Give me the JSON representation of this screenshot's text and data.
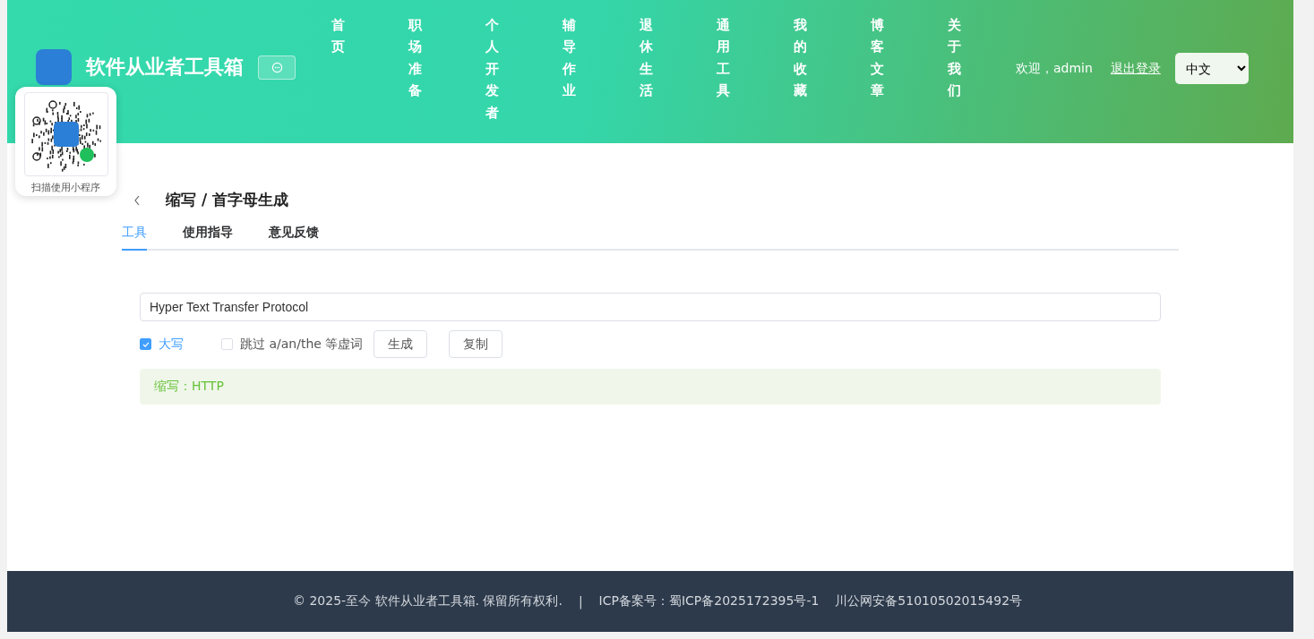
{
  "header": {
    "site_title": "软件从业者工具箱",
    "nav": [
      {
        "label": "首页"
      },
      {
        "label": "职场准备"
      },
      {
        "label": "个人开发者"
      },
      {
        "label": "辅导作业"
      },
      {
        "label": "退休生活"
      },
      {
        "label": "通用工具"
      },
      {
        "label": "我的收藏"
      },
      {
        "label": "博客文章"
      },
      {
        "label": "关于我们"
      }
    ],
    "welcome": "欢迎，admin",
    "logout": "退出登录",
    "language": "中文"
  },
  "qr_popup": {
    "caption": "扫描使用小程序"
  },
  "page": {
    "title": "缩写 / 首字母生成",
    "tabs": [
      {
        "label": "工具",
        "selected": true
      },
      {
        "label": "使用指导",
        "selected": false
      },
      {
        "label": "意见反馈",
        "selected": false
      }
    ],
    "input": {
      "value": "Hyper Text Transfer Protocol"
    },
    "options": [
      {
        "label": "大写",
        "checked": true
      },
      {
        "label": "跳过 a/an/the 等虚词",
        "checked": false
      }
    ],
    "buttons": [
      "生成",
      "复制"
    ],
    "result": "缩写：HTTP"
  },
  "footer": {
    "copyright": "© 2025-至今 软件从业者工具箱. 保留所有权利.",
    "separator": "|",
    "icp": "ICP备案号：蜀ICP备2025172395号-1",
    "police": "川公网安备51010502015492号"
  }
}
